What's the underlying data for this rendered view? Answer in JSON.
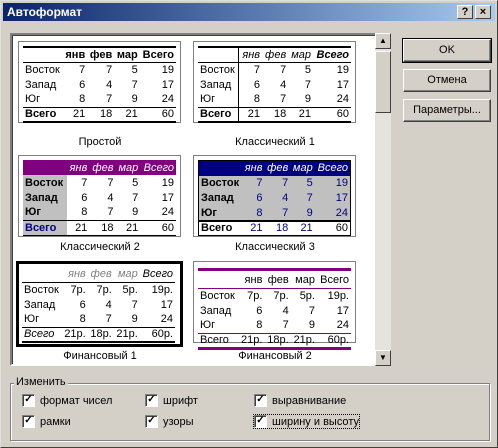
{
  "window": {
    "title": "Автоформат",
    "help": "?",
    "close": "×"
  },
  "buttons": {
    "ok": "OK",
    "cancel": "Отмена",
    "params": "Параметры..."
  },
  "scroll": {
    "up": "▲",
    "down": "▼"
  },
  "group": {
    "label": "Изменить",
    "options": [
      {
        "label": "формат чисел",
        "checked": true
      },
      {
        "label": "шрифт",
        "checked": true
      },
      {
        "label": "выравнивание",
        "checked": true
      },
      {
        "label": "рамки",
        "checked": true
      },
      {
        "label": "узоры",
        "checked": true
      },
      {
        "label": "ширину и высоту",
        "checked": true
      }
    ]
  },
  "samples": [
    {
      "name": "Простой",
      "rows": [
        [
          "",
          "янв",
          "фев",
          "мар",
          "Всего"
        ],
        [
          "Восток",
          "7",
          "7",
          "5",
          "19"
        ],
        [
          "Запад",
          "6",
          "4",
          "7",
          "17"
        ],
        [
          "Юг",
          "8",
          "7",
          "9",
          "24"
        ],
        [
          "Всего",
          "21",
          "18",
          "21",
          "60"
        ]
      ]
    },
    {
      "name": "Классический 1",
      "rows": [
        [
          "",
          "янв",
          "фев",
          "мар",
          "Всего"
        ],
        [
          "Восток",
          "7",
          "7",
          "5",
          "19"
        ],
        [
          "Запад",
          "6",
          "4",
          "7",
          "17"
        ],
        [
          "Юг",
          "8",
          "7",
          "9",
          "24"
        ],
        [
          "Всего",
          "21",
          "18",
          "21",
          "60"
        ]
      ]
    },
    {
      "name": "Классический 2",
      "rows": [
        [
          "",
          "янв",
          "фев",
          "мар",
          "Всего"
        ],
        [
          "Восток",
          "7",
          "7",
          "5",
          "19"
        ],
        [
          "Запад",
          "6",
          "4",
          "7",
          "17"
        ],
        [
          "Юг",
          "8",
          "7",
          "9",
          "24"
        ],
        [
          "Всего",
          "21",
          "18",
          "21",
          "60"
        ]
      ]
    },
    {
      "name": "Классический 3",
      "rows": [
        [
          "",
          "янв",
          "фев",
          "мар",
          "Всего"
        ],
        [
          "Восток",
          "7",
          "7",
          "5",
          "19"
        ],
        [
          "Запад",
          "6",
          "4",
          "7",
          "17"
        ],
        [
          "Юг",
          "8",
          "7",
          "9",
          "24"
        ],
        [
          "Всего",
          "21",
          "18",
          "21",
          "60"
        ]
      ]
    },
    {
      "name": "Финансовый 1",
      "rows": [
        [
          "",
          "янв",
          "фев",
          "мар",
          "Всего"
        ],
        [
          "Восток",
          "7р.",
          "7р.",
          "5р.",
          "19р."
        ],
        [
          "Запад",
          "6",
          "4",
          "7",
          "17"
        ],
        [
          "Юг",
          "8",
          "7",
          "9",
          "24"
        ],
        [
          "Всего",
          "21р.",
          "18р.",
          "21р.",
          "60р."
        ]
      ]
    },
    {
      "name": "Финансовый 2",
      "rows": [
        [
          "",
          "янв",
          "фев",
          "мар",
          "Всего"
        ],
        [
          "Восток",
          "7р.",
          "7р.",
          "5р.",
          "19р."
        ],
        [
          "Запад",
          "6",
          "4",
          "7",
          "17"
        ],
        [
          "Юг",
          "8",
          "7",
          "9",
          "24"
        ],
        [
          "Всего",
          "21р.",
          "18р.",
          "21р.",
          "60р."
        ]
      ]
    }
  ],
  "colors": {
    "purple": "#800080",
    "navy": "#000080",
    "title_start": "#0a246a",
    "title_end": "#a6caf0"
  }
}
